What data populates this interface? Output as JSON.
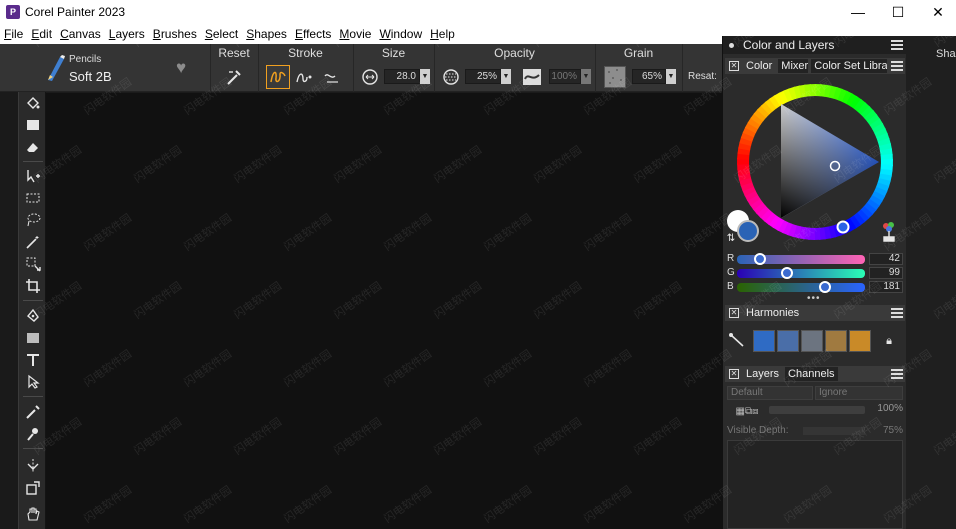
{
  "window": {
    "title": "Corel Painter 2023",
    "logo_text": "P",
    "minimize": "—",
    "maximize": "☐",
    "close": "✕"
  },
  "menu": [
    "File",
    "Edit",
    "Canvas",
    "Layers",
    "Brushes",
    "Select",
    "Shapes",
    "Effects",
    "Movie",
    "Window",
    "Help"
  ],
  "brush": {
    "category": "Pencils",
    "variant": "Soft 2B"
  },
  "propbar": {
    "reset_label": "Reset",
    "stroke_label": "Stroke",
    "size_label": "Size",
    "size_value": "28.0",
    "opacity_label": "Opacity",
    "opacity_value": "25%",
    "opacity2_value": "100%",
    "grain_label": "Grain",
    "grain_value": "65%",
    "resat_label": "Resat:"
  },
  "panel": {
    "title": "Color and Layers",
    "color_tabs": [
      "Color",
      "Mixer",
      "Color Set Libraries"
    ],
    "rgb": {
      "r": 42,
      "g": 99,
      "b": 181
    },
    "current_color": "#2a63b5",
    "secondary_color": "#ffffff",
    "harmonies_title": "Harmonies",
    "harmony_swatches": [
      "#2f6bc4",
      "#4a6ea8",
      "#6c7480",
      "#a07a40",
      "#c98a28"
    ],
    "layers_tabs": [
      "Layers",
      "Channels"
    ],
    "composite_method": "Default",
    "composite_depth": "Ignore",
    "layer_opacity": "100%",
    "visible_depth_label": "Visible Depth:",
    "visible_depth_value": "75%"
  },
  "right_panel": {
    "label": "Shap"
  },
  "watermark": "闪电软件园"
}
